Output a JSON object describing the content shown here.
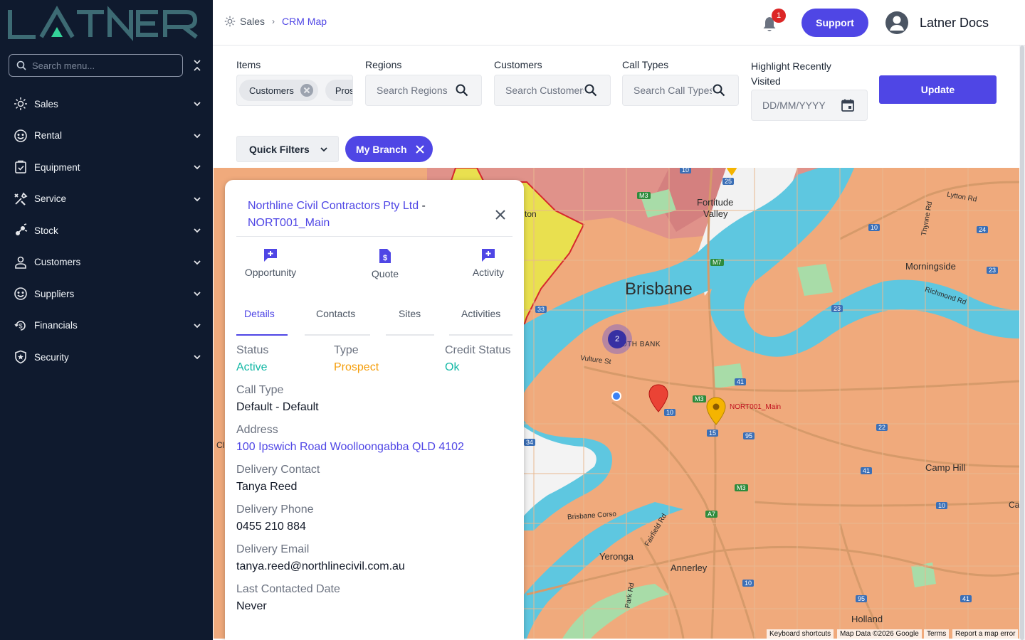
{
  "brand": {
    "logo_text": "LATNER"
  },
  "sidebar": {
    "search_placeholder": "Search menu...",
    "items": [
      {
        "label": "Sales",
        "icon": "sales-icon"
      },
      {
        "label": "Rental",
        "icon": "rental-icon"
      },
      {
        "label": "Equipment",
        "icon": "equipment-icon"
      },
      {
        "label": "Service",
        "icon": "service-icon"
      },
      {
        "label": "Stock",
        "icon": "stock-icon"
      },
      {
        "label": "Customers",
        "icon": "customers-icon"
      },
      {
        "label": "Suppliers",
        "icon": "suppliers-icon"
      },
      {
        "label": "Financials",
        "icon": "financials-icon"
      },
      {
        "label": "Security",
        "icon": "security-icon"
      }
    ]
  },
  "header": {
    "breadcrumb": {
      "parent": "Sales",
      "current": "CRM Map"
    },
    "notifications_count": "1",
    "support_label": "Support",
    "user_name": "Latner Docs"
  },
  "filters": {
    "items": {
      "label": "Items",
      "chips": [
        "Customers",
        "Prospects"
      ]
    },
    "regions": {
      "label": "Regions",
      "placeholder": "Search Regions"
    },
    "customers": {
      "label": "Customers",
      "placeholder": "Search Customers"
    },
    "call_types": {
      "label": "Call Types",
      "placeholder": "Search Call Types"
    },
    "recent": {
      "label_line1": "Highlight Recently",
      "label_line2": "Visited",
      "placeholder": "DD/MM/YYYY"
    },
    "update_label": "Update",
    "quick_filters_label": "Quick Filters",
    "branch_chip_label": "My Branch"
  },
  "map": {
    "labels": {
      "brisbane": "Brisbane",
      "fortitude_valley_1": "Fortitude",
      "fortitude_valley_2": "Valley",
      "south_bank": "SOUTH BANK",
      "vulture_st": "Vulture St",
      "morningside": "Morningside",
      "camp_hill": "Camp Hill",
      "yeronga": "Yeronga",
      "annerley": "Annerley",
      "holland": "Holland",
      "lytton_rd": "Lytton Rd",
      "richmond_rd": "Richmond Rd",
      "thynne_rd": "Thynne Rd",
      "brisbane_corso": "Brisbane Corso",
      "fairfield_rd": "Fairfield Rd",
      "park_rd": "Park Rd",
      "marker_label": "NORT001_Main",
      "cluster_count": "2",
      "edge_on": "ton",
      "edge_ca": "Ca",
      "edge_cl": "Cl"
    },
    "shields": [
      "10",
      "25",
      "M3",
      "M7",
      "33",
      "23",
      "24",
      "10",
      "23",
      "41",
      "M3",
      "10",
      "15",
      "95",
      "22",
      "34",
      "41",
      "M3",
      "A7",
      "10",
      "10",
      "95",
      "41"
    ],
    "attribution": {
      "shortcuts": "Keyboard shortcuts",
      "data": "Map Data ©2026 Google",
      "terms": "Terms",
      "report": "Report a map error"
    }
  },
  "panel": {
    "title_name": "Northline Civil Contractors Pty Ltd",
    "title_dash": " -",
    "title_code": "NORT001_Main",
    "actions": [
      "Opportunity",
      "Quote",
      "Activity"
    ],
    "tabs": [
      "Details",
      "Contacts",
      "Sites",
      "Activities"
    ],
    "fields": {
      "status_label": "Status",
      "status_value": "Active",
      "type_label": "Type",
      "type_value": "Prospect",
      "credit_label": "Credit Status",
      "credit_value": "Ok",
      "call_type_label": "Call Type",
      "call_type_value": "Default - Default",
      "address_label": "Address",
      "address_value": "100 Ipswich Road Woolloongabba QLD 4102",
      "delivery_contact_label": "Delivery Contact",
      "delivery_contact_value": "Tanya Reed",
      "delivery_phone_label": "Delivery Phone",
      "delivery_phone_value": "0455 210 884",
      "delivery_email_label": "Delivery Email",
      "delivery_email_value": "tanya.reed@northlinecivil.com.au",
      "last_contacted_label": "Last Contacted Date",
      "last_contacted_value": "Never"
    }
  },
  "colors": {
    "accent": "#4f46e5",
    "sidebar_bg": "#0f1a2e",
    "status_active": "#14b8a6",
    "type_prospect": "#f59e0b",
    "credit_ok": "#14b8a6"
  }
}
